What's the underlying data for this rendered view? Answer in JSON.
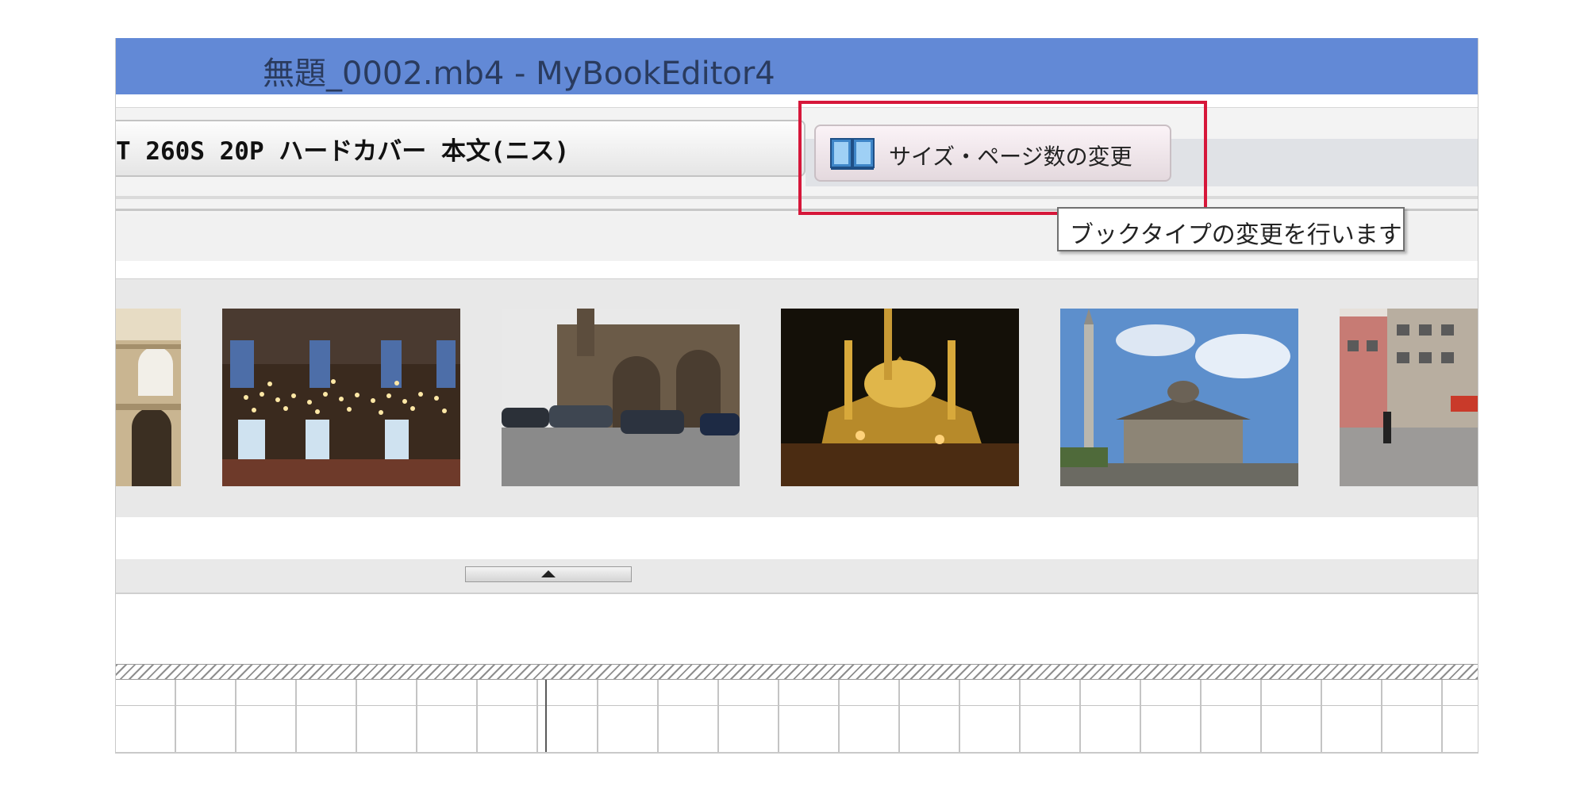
{
  "window": {
    "title": "無題_0002.mb4 - MyBookEditor4"
  },
  "toolbar": {
    "book_type_label": "T 260S 20P ハードカバー 本文(ニス)",
    "size_button_label": "サイズ・ページ数の変更",
    "size_button_icon": "book-icon",
    "tooltip": "ブックタイプの変更を行います"
  },
  "photo_strip": {
    "thumbnails": [
      {
        "subject": "colosseum arches"
      },
      {
        "subject": "mosque interior with lamps"
      },
      {
        "subject": "brick ruins with parked cars"
      },
      {
        "subject": "mosque at night"
      },
      {
        "subject": "fountain pavilion with minaret"
      },
      {
        "subject": "city street with buildings"
      }
    ]
  },
  "splitter": {
    "icon": "arrow-up-icon"
  },
  "colors": {
    "titlebar": "#6289d6",
    "highlight": "#d6173a"
  }
}
